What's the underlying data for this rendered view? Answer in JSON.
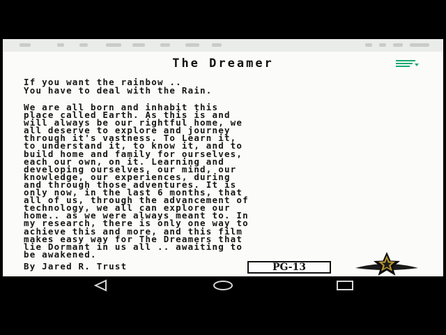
{
  "header": {
    "title": "The Dreamer"
  },
  "quote": {
    "lines": [
      "If you want the rainbow ..",
      "You have to deal with the Rain."
    ]
  },
  "body": {
    "lines": [
      "We are all born and inhabit this",
      "place called Earth. As this is and",
      "will always be our rightful home, we",
      "all deserve to explore and journey",
      "through it's vastness. To Learn it,",
      "to understand it, to know it, and to",
      "build home and family for ourselves,",
      "each our own, on it. Learning and",
      "developing ourselves, our mind, our",
      "knowledge, our experiences, during",
      "and through those adventures. It is",
      "only now, in the last 6 months, that",
      "all of us, through the advancement of",
      "technology, we all can explore our",
      "home.. as we were always meant to. In",
      "my research, there is only one way to",
      "achieve this and more, and this film",
      "makes easy way for The Dreamers that",
      "lie Dormant in us all .. awaiting to",
      "be awakened."
    ]
  },
  "footer": {
    "author": "By Jared R. Trust",
    "rating": "PG-13"
  },
  "icons": {
    "menu": "menu-icon",
    "star": "star-icon",
    "back": "back-icon",
    "home": "home-icon",
    "recents": "recents-icon"
  },
  "colors": {
    "accent": "#19a974",
    "page_background": "#fbfbf9",
    "text": "#151515"
  }
}
